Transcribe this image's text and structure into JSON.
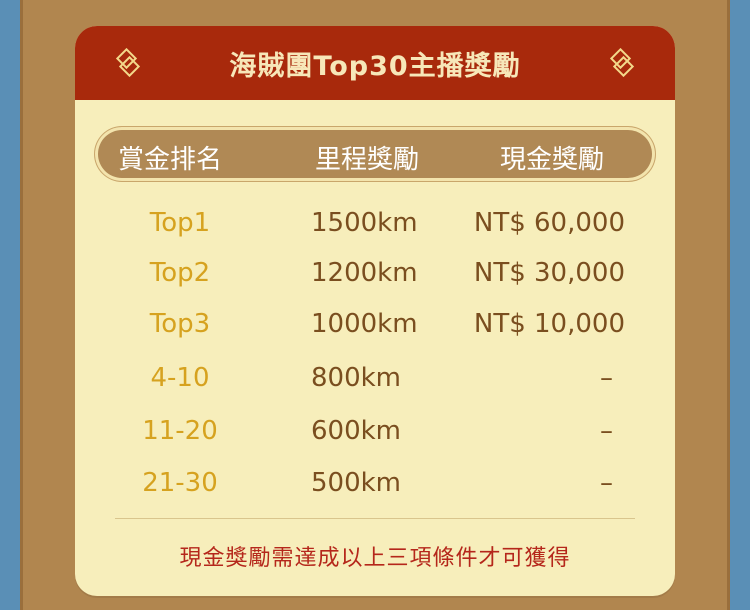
{
  "header": {
    "title": "海賊團Top30主播獎勵"
  },
  "columns": {
    "rank": "賞金排名",
    "distance": "里程獎勵",
    "cash": "現金獎勵"
  },
  "rows": [
    {
      "rank": "Top1",
      "distance": "1500km",
      "cash": "NT$ 60,000"
    },
    {
      "rank": "Top2",
      "distance": "1200km",
      "cash": "NT$ 30,000"
    },
    {
      "rank": "Top3",
      "distance": "1000km",
      "cash": "NT$ 10,000"
    },
    {
      "rank": "4-10",
      "distance": "800km",
      "cash": "–"
    },
    {
      "rank": "11-20",
      "distance": "600km",
      "cash": "–"
    },
    {
      "rank": "21-30",
      "distance": "500km",
      "cash": "–"
    }
  ],
  "footnote": "現金獎勵需達成以上三項條件才可獲得",
  "colors": {
    "header_bg": "#a8290c",
    "card_bg": "#f7eebb",
    "rank_text": "#d6a21f",
    "value_text": "#7a4e1f",
    "note_text": "#b5271b"
  }
}
